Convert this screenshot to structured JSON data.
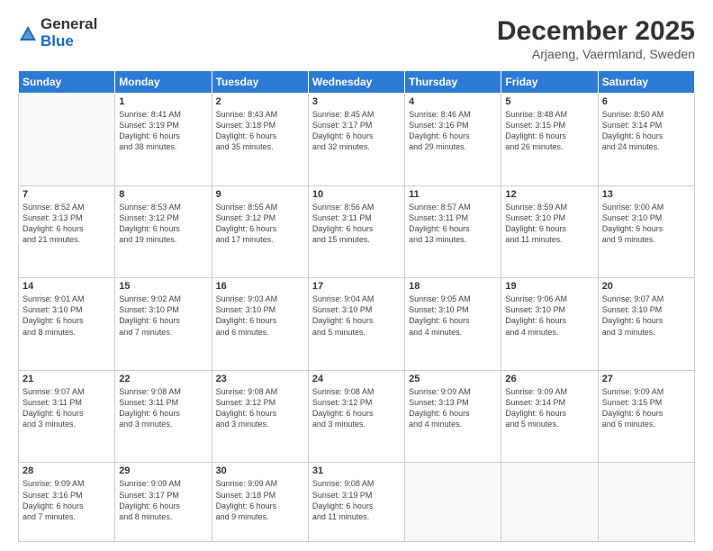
{
  "logo": {
    "general": "General",
    "blue": "Blue"
  },
  "title": {
    "month": "December 2025",
    "location": "Arjaeng, Vaermland, Sweden"
  },
  "weekdays": [
    "Sunday",
    "Monday",
    "Tuesday",
    "Wednesday",
    "Thursday",
    "Friday",
    "Saturday"
  ],
  "weeks": [
    [
      {
        "day": "",
        "text": ""
      },
      {
        "day": "1",
        "text": "Sunrise: 8:41 AM\nSunset: 3:19 PM\nDaylight: 6 hours\nand 38 minutes."
      },
      {
        "day": "2",
        "text": "Sunrise: 8:43 AM\nSunset: 3:18 PM\nDaylight: 6 hours\nand 35 minutes."
      },
      {
        "day": "3",
        "text": "Sunrise: 8:45 AM\nSunset: 3:17 PM\nDaylight: 6 hours\nand 32 minutes."
      },
      {
        "day": "4",
        "text": "Sunrise: 8:46 AM\nSunset: 3:16 PM\nDaylight: 6 hours\nand 29 minutes."
      },
      {
        "day": "5",
        "text": "Sunrise: 8:48 AM\nSunset: 3:15 PM\nDaylight: 6 hours\nand 26 minutes."
      },
      {
        "day": "6",
        "text": "Sunrise: 8:50 AM\nSunset: 3:14 PM\nDaylight: 6 hours\nand 24 minutes."
      }
    ],
    [
      {
        "day": "7",
        "text": "Sunrise: 8:52 AM\nSunset: 3:13 PM\nDaylight: 6 hours\nand 21 minutes."
      },
      {
        "day": "8",
        "text": "Sunrise: 8:53 AM\nSunset: 3:12 PM\nDaylight: 6 hours\nand 19 minutes."
      },
      {
        "day": "9",
        "text": "Sunrise: 8:55 AM\nSunset: 3:12 PM\nDaylight: 6 hours\nand 17 minutes."
      },
      {
        "day": "10",
        "text": "Sunrise: 8:56 AM\nSunset: 3:11 PM\nDaylight: 6 hours\nand 15 minutes."
      },
      {
        "day": "11",
        "text": "Sunrise: 8:57 AM\nSunset: 3:11 PM\nDaylight: 6 hours\nand 13 minutes."
      },
      {
        "day": "12",
        "text": "Sunrise: 8:59 AM\nSunset: 3:10 PM\nDaylight: 6 hours\nand 11 minutes."
      },
      {
        "day": "13",
        "text": "Sunrise: 9:00 AM\nSunset: 3:10 PM\nDaylight: 6 hours\nand 9 minutes."
      }
    ],
    [
      {
        "day": "14",
        "text": "Sunrise: 9:01 AM\nSunset: 3:10 PM\nDaylight: 6 hours\nand 8 minutes."
      },
      {
        "day": "15",
        "text": "Sunrise: 9:02 AM\nSunset: 3:10 PM\nDaylight: 6 hours\nand 7 minutes."
      },
      {
        "day": "16",
        "text": "Sunrise: 9:03 AM\nSunset: 3:10 PM\nDaylight: 6 hours\nand 6 minutes."
      },
      {
        "day": "17",
        "text": "Sunrise: 9:04 AM\nSunset: 3:10 PM\nDaylight: 6 hours\nand 5 minutes."
      },
      {
        "day": "18",
        "text": "Sunrise: 9:05 AM\nSunset: 3:10 PM\nDaylight: 6 hours\nand 4 minutes."
      },
      {
        "day": "19",
        "text": "Sunrise: 9:06 AM\nSunset: 3:10 PM\nDaylight: 6 hours\nand 4 minutes."
      },
      {
        "day": "20",
        "text": "Sunrise: 9:07 AM\nSunset: 3:10 PM\nDaylight: 6 hours\nand 3 minutes."
      }
    ],
    [
      {
        "day": "21",
        "text": "Sunrise: 9:07 AM\nSunset: 3:11 PM\nDaylight: 6 hours\nand 3 minutes."
      },
      {
        "day": "22",
        "text": "Sunrise: 9:08 AM\nSunset: 3:11 PM\nDaylight: 6 hours\nand 3 minutes."
      },
      {
        "day": "23",
        "text": "Sunrise: 9:08 AM\nSunset: 3:12 PM\nDaylight: 6 hours\nand 3 minutes."
      },
      {
        "day": "24",
        "text": "Sunrise: 9:08 AM\nSunset: 3:12 PM\nDaylight: 6 hours\nand 3 minutes."
      },
      {
        "day": "25",
        "text": "Sunrise: 9:09 AM\nSunset: 3:13 PM\nDaylight: 6 hours\nand 4 minutes."
      },
      {
        "day": "26",
        "text": "Sunrise: 9:09 AM\nSunset: 3:14 PM\nDaylight: 6 hours\nand 5 minutes."
      },
      {
        "day": "27",
        "text": "Sunrise: 9:09 AM\nSunset: 3:15 PM\nDaylight: 6 hours\nand 6 minutes."
      }
    ],
    [
      {
        "day": "28",
        "text": "Sunrise: 9:09 AM\nSunset: 3:16 PM\nDaylight: 6 hours\nand 7 minutes."
      },
      {
        "day": "29",
        "text": "Sunrise: 9:09 AM\nSunset: 3:17 PM\nDaylight: 6 hours\nand 8 minutes."
      },
      {
        "day": "30",
        "text": "Sunrise: 9:09 AM\nSunset: 3:18 PM\nDaylight: 6 hours\nand 9 minutes."
      },
      {
        "day": "31",
        "text": "Sunrise: 9:08 AM\nSunset: 3:19 PM\nDaylight: 6 hours\nand 11 minutes."
      },
      {
        "day": "",
        "text": ""
      },
      {
        "day": "",
        "text": ""
      },
      {
        "day": "",
        "text": ""
      }
    ]
  ]
}
